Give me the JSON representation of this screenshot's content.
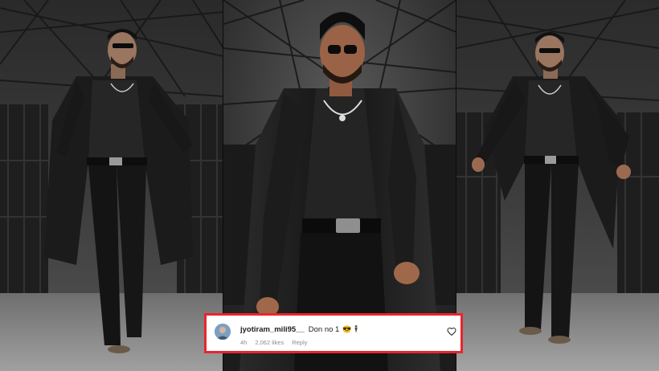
{
  "comment": {
    "username": "jyotiram_mili95__",
    "text": "Don no 1",
    "emoji": "😎🕴",
    "time": "4h",
    "likes": "2,062 likes",
    "reply": "Reply"
  },
  "colors": {
    "highlight_border": "#e8262c",
    "comment_bg": "#ffffff",
    "meta_text": "#8e8e8e"
  },
  "icons": [
    "user-avatar",
    "heart-icon"
  ]
}
